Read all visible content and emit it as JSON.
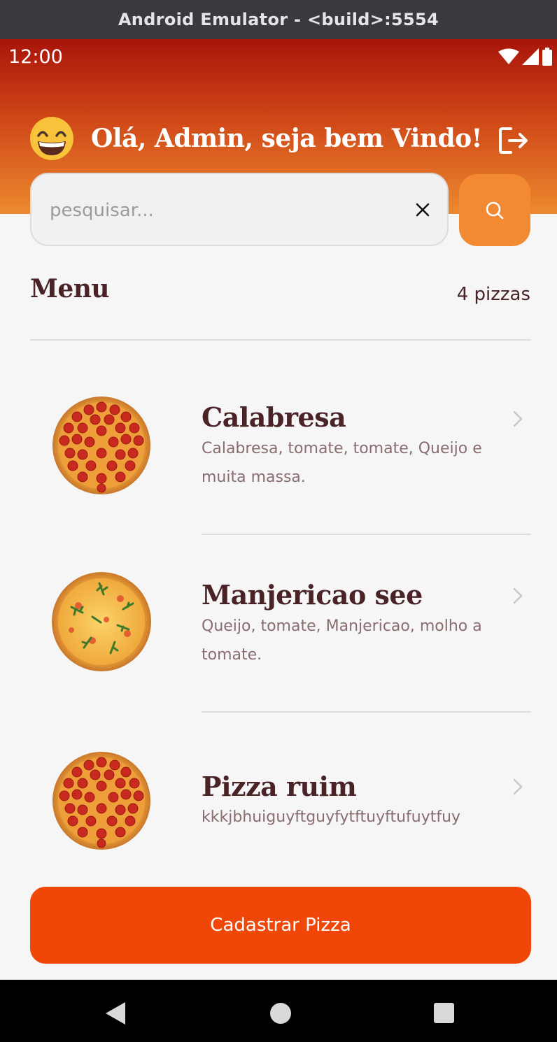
{
  "window": {
    "title": "Android Emulator - <build>:5554"
  },
  "status_bar": {
    "time": "12:00"
  },
  "header": {
    "greeting": "Olá, Admin, seja bem Vindo!"
  },
  "search": {
    "placeholder": "pesquisar...",
    "value": ""
  },
  "menu": {
    "title": "Menu",
    "count": "4 pizzas",
    "items": [
      {
        "name": "Calabresa",
        "description": "Calabresa, tomate, tomate, Queijo e muita massa.",
        "image": "pepperoni-pizza"
      },
      {
        "name": "Manjericao see",
        "description": "Queijo, tomate, Manjericao, molho a tomate.",
        "image": "basil-pizza"
      },
      {
        "name": "Pizza ruim",
        "description": "kkkjbhuiguyftguyfytftuyftufuytfuy",
        "image": "pepperoni-pizza"
      }
    ]
  },
  "cta": {
    "label": "Cadastrar Pizza"
  },
  "colors": {
    "primary": "#f04709",
    "accent": "#f28a33",
    "header_top": "#a8150a",
    "text_dark": "#4a2327"
  }
}
